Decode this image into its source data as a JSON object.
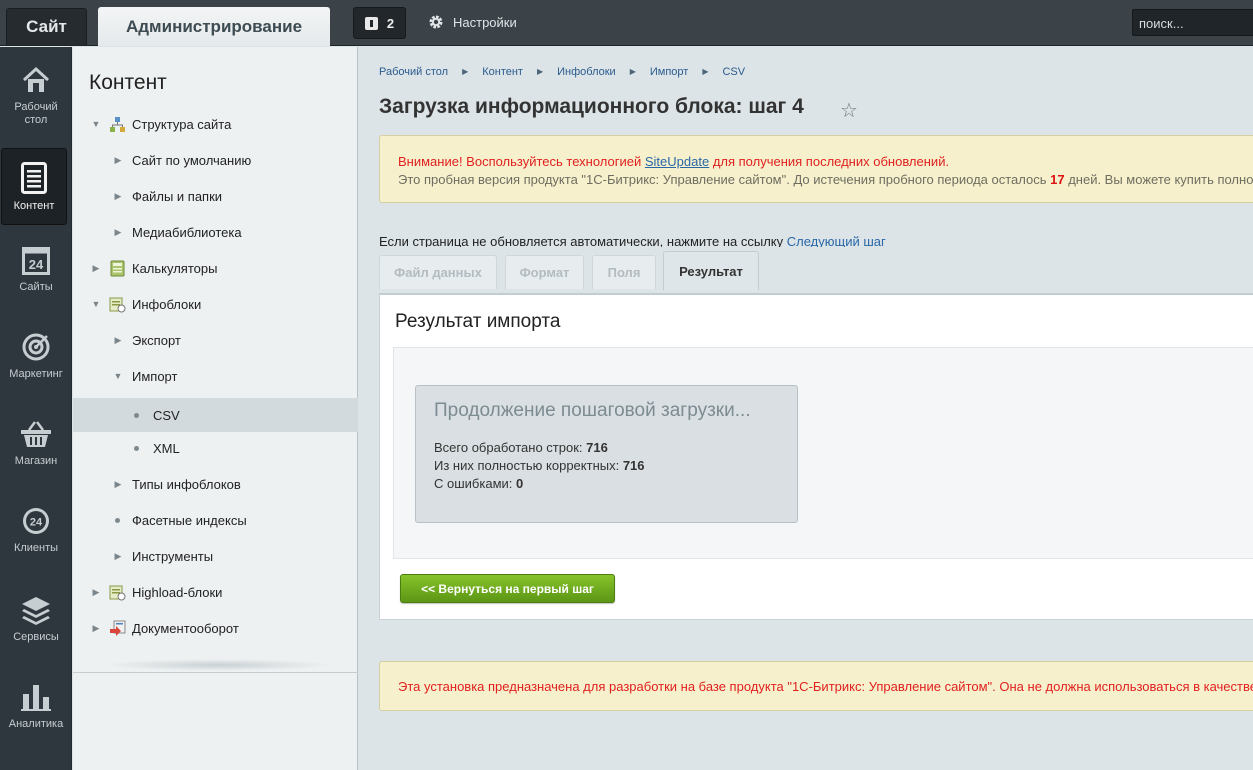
{
  "topbar": {
    "site_label": "Сайт",
    "admin_label": "Администрирование",
    "notifications_count": "2",
    "settings_label": "Настройки",
    "search_placeholder": "поиск..."
  },
  "iconbar": [
    {
      "label": "Рабочий стол",
      "icon": "home-icon"
    },
    {
      "label": "Контент",
      "icon": "document-icon"
    },
    {
      "label": "Сайты",
      "icon": "calendar-24-icon"
    },
    {
      "label": "Маркетинг",
      "icon": "target-icon"
    },
    {
      "label": "Магазин",
      "icon": "basket-icon"
    },
    {
      "label": "Клиенты",
      "icon": "clients-24-icon"
    },
    {
      "label": "Сервисы",
      "icon": "layers-icon"
    },
    {
      "label": "Аналитика",
      "icon": "bar-chart-icon"
    }
  ],
  "nav": {
    "title": "Контент",
    "items": [
      {
        "label": "Структура сайта"
      },
      {
        "label": "Сайт по умолчанию"
      },
      {
        "label": "Файлы и папки"
      },
      {
        "label": "Медиабиблиотека"
      },
      {
        "label": "Калькуляторы"
      },
      {
        "label": "Инфоблоки"
      },
      {
        "label": "Экспорт"
      },
      {
        "label": "Импорт"
      },
      {
        "label": "CSV"
      },
      {
        "label": "XML"
      },
      {
        "label": "Типы инфоблоков"
      },
      {
        "label": "Фасетные индексы"
      },
      {
        "label": "Инструменты"
      },
      {
        "label": "Highload-блоки"
      },
      {
        "label": "Документооборот"
      }
    ]
  },
  "breadcrumbs": [
    "Рабочий стол",
    "Контент",
    "Инфоблоки",
    "Импорт",
    "CSV"
  ],
  "page_title": "Загрузка информационного блока: шаг 4",
  "notice": {
    "warning_prefix": "Внимание! Воспользуйтесь технологией ",
    "link": "SiteUpdate",
    "warning_suffix": " для получения последних обновлений.",
    "trial_prefix": "Это пробная версия продукта \"1С-Битрикс: Управление сайтом\". До истечения пробного периода осталось ",
    "trial_days": "17",
    "trial_suffix": " дней. Вы можете купить полно"
  },
  "refresh": {
    "text": "Если страница не обновляется автоматически, нажмите на ссылку ",
    "link": "Следующий шаг"
  },
  "tabs": [
    {
      "label": "Файл данных"
    },
    {
      "label": "Формат"
    },
    {
      "label": "Поля"
    },
    {
      "label": "Результат"
    }
  ],
  "result": {
    "title": "Результат импорта",
    "progress_title": "Продолжение пошаговой загрузки...",
    "total_label": "Всего обработано строк: ",
    "total_value": "716",
    "correct_label": "Из них полностью корректных: ",
    "correct_value": "716",
    "errors_label": "С ошибками: ",
    "errors_value": "0"
  },
  "back_button": "<< Вернуться на первый шаг",
  "footer_notice": "Эта установка предназначена для разработки на базе продукта \"1С-Битрикс: Управление сайтом\". Она не должна использоваться в качестве"
}
